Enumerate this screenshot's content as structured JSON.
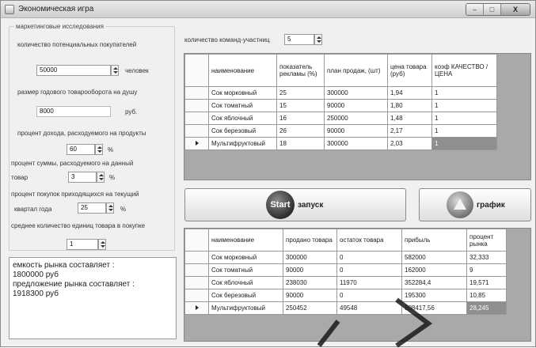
{
  "window": {
    "title": "Экономическая игра",
    "controls": [
      "–",
      "□",
      "X"
    ]
  },
  "marketing": {
    "group_title": "маркетинговые исследования",
    "buyers_label": "количество потенциальных покупателей",
    "buyers_value": "50000",
    "buyers_unit": "человек",
    "turnover_label": "размер годового товарооборота на душу",
    "turnover_value": "8000",
    "turnover_unit": "руб.",
    "food_label": "процент дохода, расходуемого на продукты",
    "food_value": "60",
    "food_unit": "%",
    "product_label_1": "процент суммы, расходуемого на данный",
    "product_label_2": "товар",
    "product_value": "3",
    "product_unit": "%",
    "quarter_label_1": "процент покупок приходящихся на текущий",
    "quarter_label_2": "квартал года",
    "quarter_value": "25",
    "quarter_unit": "%",
    "avg_label": "среднее количество единиц товара в покупке",
    "avg_value": "1"
  },
  "results": {
    "capacity": "емкость рынка составляет :",
    "capacity_value": "1800000 руб",
    "supply": "предложение рынка составляет :",
    "supply_value": "1918300 руб"
  },
  "teams": {
    "label": "количество команд-участниц",
    "value": "5"
  },
  "table1": {
    "headers": [
      "наименование",
      "показатель рекламы (%)",
      "план продаж, (шт)",
      "цена товара (руб)",
      "коэф КАЧЕСТВО / ЦЕНА"
    ],
    "rows": [
      [
        "Сок морковный",
        "25",
        "300000",
        "1,94",
        "1"
      ],
      [
        "Сок томатный",
        "15",
        "90000",
        "1,80",
        "1"
      ],
      [
        "Сок яблочный",
        "16",
        "250000",
        "1,48",
        "1"
      ],
      [
        "Сок березовый",
        "26",
        "90000",
        "2,17",
        "1"
      ],
      [
        "Мультифруктовый",
        "18",
        "300000",
        "2,03",
        "1"
      ]
    ]
  },
  "buttons": {
    "start_orb": "Start",
    "start_label": "запуск",
    "chart_label": "график"
  },
  "table2": {
    "headers": [
      "наименование",
      "продано товара",
      "остаток товара",
      "прибыль",
      "процент рынка"
    ],
    "rows": [
      [
        "Сок морковный",
        "300000",
        "0",
        "582000",
        "32,333"
      ],
      [
        "Сок томатный",
        "90000",
        "0",
        "162000",
        "9"
      ],
      [
        "Сок яблочный",
        "238030",
        "11970",
        "352284,4",
        "19,571"
      ],
      [
        "Сок березовый",
        "90000",
        "0",
        "195300",
        "10,85"
      ],
      [
        "Мультифруктовый",
        "250452",
        "49548",
        "508417,56",
        "28,245"
      ]
    ]
  }
}
